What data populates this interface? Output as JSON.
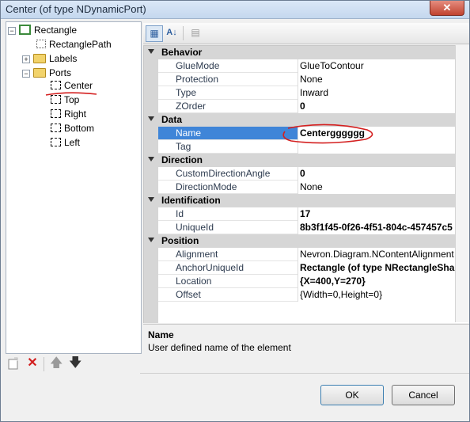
{
  "window": {
    "title": "Center (of type NDynamicPort)",
    "close_glyph": "✕"
  },
  "tree": {
    "root": {
      "label": "Rectangle",
      "expander": "−"
    },
    "rectangle_path": {
      "label": "RectanglePath"
    },
    "labels": {
      "label": "Labels",
      "expander": "+"
    },
    "ports": {
      "label": "Ports",
      "expander": "−"
    },
    "port_items": [
      "Center",
      "Top",
      "Right",
      "Bottom",
      "Left"
    ]
  },
  "tree_toolbar": {
    "add_icon": "new-document-icon",
    "delete_icon": "delete-x-icon",
    "up_icon": "arrow-up-icon",
    "down_icon": "arrow-down-icon",
    "delete_glyph": "✕",
    "up_glyph": "🡅",
    "down_glyph": "🡇"
  },
  "grid_toolbar": {
    "categorized_glyph": "▦",
    "alphabetical_glyph": "A↓",
    "pages_glyph": "▤"
  },
  "property_grid": {
    "categories": [
      {
        "name": "Behavior",
        "toggle": "▾",
        "properties": [
          {
            "name": "GlueMode",
            "value": "GlueToContour",
            "bold": false
          },
          {
            "name": "Protection",
            "value": "None",
            "bold": false
          },
          {
            "name": "Type",
            "value": "Inward",
            "bold": false
          },
          {
            "name": "ZOrder",
            "value": "0",
            "bold": true
          }
        ]
      },
      {
        "name": "Data",
        "toggle": "▾",
        "properties": [
          {
            "name": "Name",
            "value": "Centergggggg",
            "bold": true,
            "selected": true
          },
          {
            "name": "Tag",
            "value": "",
            "bold": false
          }
        ]
      },
      {
        "name": "Direction",
        "toggle": "▾",
        "properties": [
          {
            "name": "CustomDirectionAngle",
            "value": "0",
            "bold": true
          },
          {
            "name": "DirectionMode",
            "value": "None",
            "bold": false
          }
        ]
      },
      {
        "name": "Identification",
        "toggle": "▾",
        "properties": [
          {
            "name": "Id",
            "value": "17",
            "bold": true
          },
          {
            "name": "UniqueId",
            "value": "8b3f1f45-0f26-4f51-804c-457457c5",
            "bold": true
          }
        ]
      },
      {
        "name": "Position",
        "toggle": "▾",
        "properties": [
          {
            "name": "Alignment",
            "value": "Nevron.Diagram.NContentAlignment",
            "bold": false
          },
          {
            "name": "AnchorUniqueId",
            "value": "Rectangle (of type NRectangleSha",
            "bold": true
          },
          {
            "name": "Location",
            "value": "{X=400,Y=270}",
            "bold": true
          },
          {
            "name": "Offset",
            "value": "{Width=0,Height=0}",
            "bold": false
          }
        ]
      }
    ]
  },
  "description": {
    "title": "Name",
    "text": "User defined name of the element"
  },
  "buttons": {
    "ok": "OK",
    "cancel": "Cancel"
  },
  "annotation_color": "#d42020"
}
